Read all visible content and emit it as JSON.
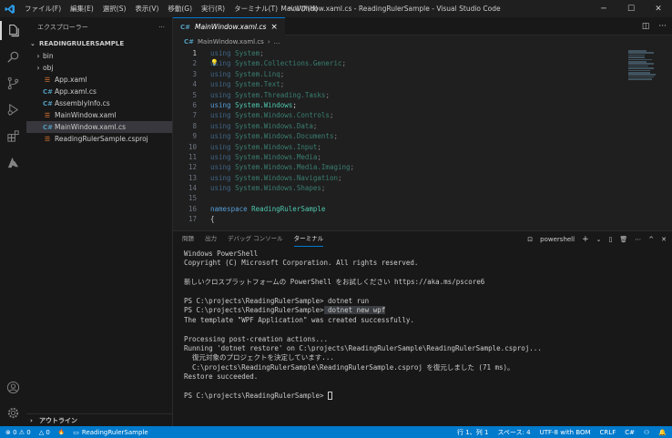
{
  "window": {
    "title": "MainWindow.xaml.cs - ReadingRulerSample - Visual Studio Code",
    "menu": [
      "ファイル(F)",
      "編集(E)",
      "選択(S)",
      "表示(V)",
      "移動(G)",
      "実行(R)",
      "ターミナル(T)",
      "ヘルプ(H)"
    ],
    "controls": {
      "minimize": "─",
      "maximize": "☐",
      "close": "✕"
    }
  },
  "activity_bar": [
    "explorer-icon",
    "search-icon",
    "source-control-icon",
    "run-debug-icon",
    "extensions-icon",
    "azure-icon",
    "account-icon",
    "settings-gear-icon"
  ],
  "sidebar": {
    "header": "エクスプローラー",
    "more": "···",
    "project": "READINGRULERSAMPLE",
    "items": [
      {
        "label": "bin",
        "type": "folder",
        "icon": ""
      },
      {
        "label": "obj",
        "type": "folder",
        "icon": ""
      },
      {
        "label": "App.xaml",
        "type": "xaml",
        "icon": "☰"
      },
      {
        "label": "App.xaml.cs",
        "type": "cs",
        "icon": "C#"
      },
      {
        "label": "AssemblyInfo.cs",
        "type": "cs",
        "icon": "C#"
      },
      {
        "label": "MainWindow.xaml",
        "type": "xaml",
        "icon": "☰"
      },
      {
        "label": "MainWindow.xaml.cs",
        "type": "cs",
        "icon": "C#",
        "selected": true
      },
      {
        "label": "ReadingRulerSample.csproj",
        "type": "csproj",
        "icon": "☰"
      }
    ],
    "outline": "アウトライン"
  },
  "editor": {
    "tab": {
      "label": "MainWindow.xaml.cs",
      "icon": "C#",
      "close": "×"
    },
    "breadcrumb": [
      "MainWindow.xaml.cs",
      "..."
    ],
    "lines": [
      {
        "n": "1",
        "kw": "using",
        "ns": "System",
        "rest": ";",
        "dim": true
      },
      {
        "n": "2",
        "kw": "using",
        "ns": "System.Collections.Generic",
        "rest": ";",
        "dim": true,
        "bulb": true
      },
      {
        "n": "3",
        "kw": "using",
        "ns": "System.Linq",
        "rest": ";",
        "dim": true
      },
      {
        "n": "4",
        "kw": "using",
        "ns": "System.Text",
        "rest": ";",
        "dim": true
      },
      {
        "n": "5",
        "kw": "using",
        "ns": "System.Threading.Tasks",
        "rest": ";",
        "dim": true
      },
      {
        "n": "6",
        "kw": "using",
        "ns": "System.Windows",
        "rest": ";",
        "dim": false
      },
      {
        "n": "7",
        "kw": "using",
        "ns": "System.Windows.Controls",
        "rest": ";",
        "dim": true
      },
      {
        "n": "8",
        "kw": "using",
        "ns": "System.Windows.Data",
        "rest": ";",
        "dim": true
      },
      {
        "n": "9",
        "kw": "using",
        "ns": "System.Windows.Documents",
        "rest": ";",
        "dim": true
      },
      {
        "n": "10",
        "kw": "using",
        "ns": "System.Windows.Input",
        "rest": ";",
        "dim": true
      },
      {
        "n": "11",
        "kw": "using",
        "ns": "System.Windows.Media",
        "rest": ";",
        "dim": true
      },
      {
        "n": "12",
        "kw": "using",
        "ns": "System.Windows.Media.Imaging",
        "rest": ";",
        "dim": true
      },
      {
        "n": "13",
        "kw": "using",
        "ns": "System.Windows.Navigation",
        "rest": ";",
        "dim": true
      },
      {
        "n": "14",
        "kw": "using",
        "ns": "System.Windows.Shapes",
        "rest": ";",
        "dim": true
      },
      {
        "n": "15",
        "kw": "",
        "ns": "",
        "rest": "",
        "dim": false
      },
      {
        "n": "16",
        "kw": "namespace",
        "ns": "ReadingRulerSample",
        "rest": "",
        "dim": false
      },
      {
        "n": "17",
        "kw": "",
        "ns": "",
        "rest": "{",
        "dim": false
      }
    ]
  },
  "panel": {
    "tabs": [
      "問題",
      "出力",
      "デバッグ コンソール",
      "ターミナル"
    ],
    "active_tab": 3,
    "shell": "powershell",
    "actions": [
      "+",
      "⌄",
      "▯",
      "🗑",
      "⋯",
      "^",
      "✕"
    ],
    "terminal_lines": [
      "Windows PowerShell",
      "Copyright (C) Microsoft Corporation. All rights reserved.",
      "",
      "新しいクロスプラットフォームの PowerShell をお試しください https://aka.ms/pscore6",
      "",
      "PS C:\\projects\\ReadingRulerSample> dotnet run",
      "PS C:\\projects\\ReadingRulerSample> dotnet new wpf",
      "The template \"WPF Application\" was created successfully.",
      "",
      "Processing post-creation actions...",
      "Running 'dotnet restore' on C:\\projects\\ReadingRulerSample\\ReadingRulerSample.csproj...",
      "  復元対象のプロジェクトを決定しています...",
      "  C:\\projects\\ReadingRulerSample\\ReadingRulerSample.csproj を復元しました (71 ms)。",
      "Restore succeeded.",
      "",
      "PS C:\\projects\\ReadingRulerSample> "
    ]
  },
  "status_bar": {
    "left": {
      "errors": "⊗ 0 ⚠ 0",
      "warnings": "△ 0",
      "flame": "🔥",
      "project": "ReadingRulerSample"
    },
    "right": [
      "行 1、列 1",
      "スペース: 4",
      "UTF-8 with BOM",
      "CRLF",
      "C#",
      "⚇",
      "🔔"
    ]
  },
  "colors": {
    "accent": "#007acc",
    "keyword": "#569cd6",
    "type": "#4ec9b0"
  }
}
